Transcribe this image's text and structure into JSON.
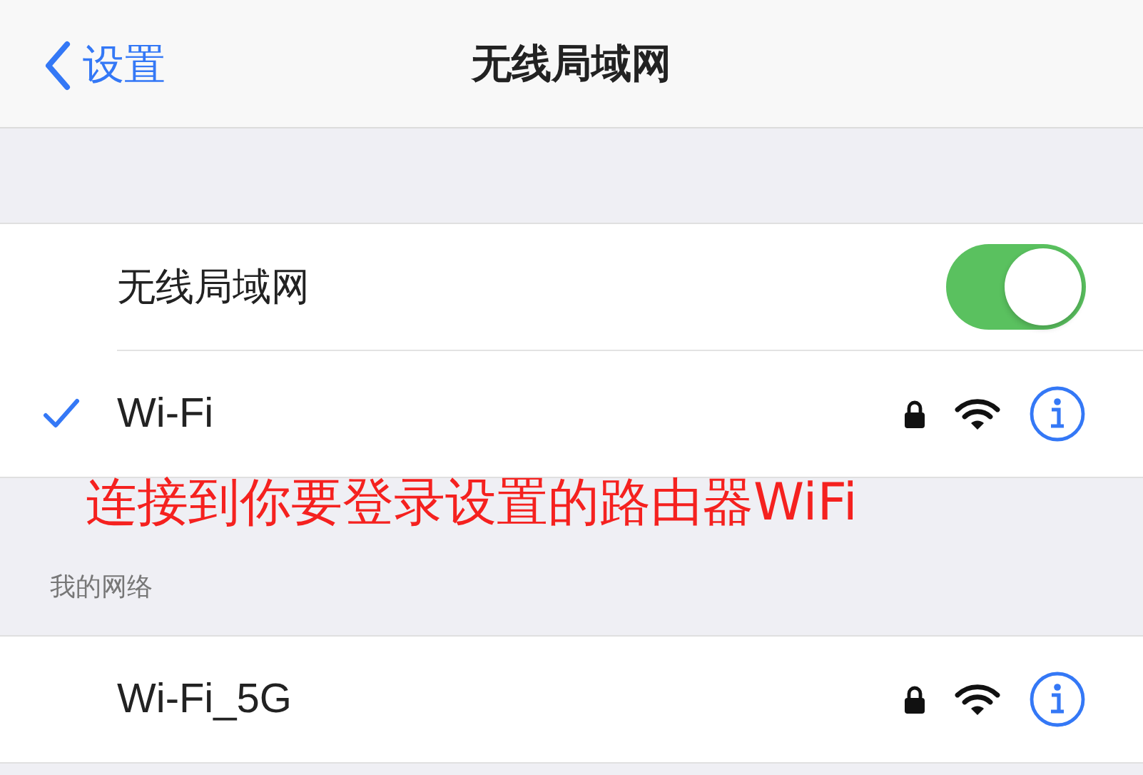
{
  "nav": {
    "back_label": "设置",
    "title": "无线局域网"
  },
  "wifi_toggle": {
    "label": "无线局域网",
    "on": true
  },
  "current_network": {
    "name": "Wi-Fi",
    "selected": true,
    "locked": true
  },
  "annotation": "连接到你要登录设置的路由器WiFi",
  "my_networks": {
    "header": "我的网络",
    "networks": [
      {
        "name": "Wi-Fi_5G",
        "selected": false,
        "locked": true
      }
    ]
  }
}
